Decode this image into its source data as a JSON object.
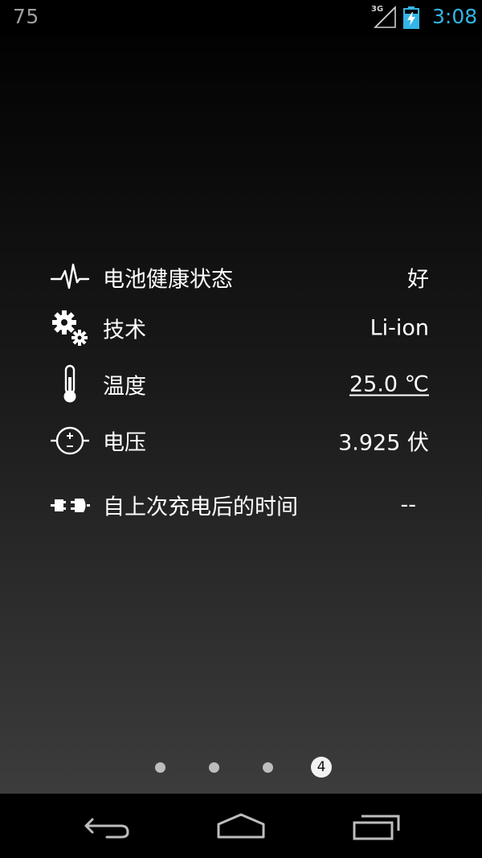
{
  "status_bar": {
    "battery_level": "75",
    "network_type": "3G",
    "time": "3:08",
    "accent_color": "#33b5e5"
  },
  "info_rows": [
    {
      "icon": "heartbeat-icon",
      "label": "电池健康状态",
      "value": "好"
    },
    {
      "icon": "gears-icon",
      "label": "技术",
      "value": "Li-ion"
    },
    {
      "icon": "thermometer-icon",
      "label": "温度",
      "value": "25.0 ℃"
    },
    {
      "icon": "voltage-icon",
      "label": "电压",
      "value": "3.925 伏"
    },
    {
      "icon": "plug-icon",
      "label": "自上次充电后的时间",
      "value": "--"
    }
  ],
  "page_indicator": {
    "total": 4,
    "active_page": "4"
  },
  "nav_bar": {
    "buttons": [
      "back-icon",
      "home-icon",
      "recent-apps-icon"
    ]
  }
}
